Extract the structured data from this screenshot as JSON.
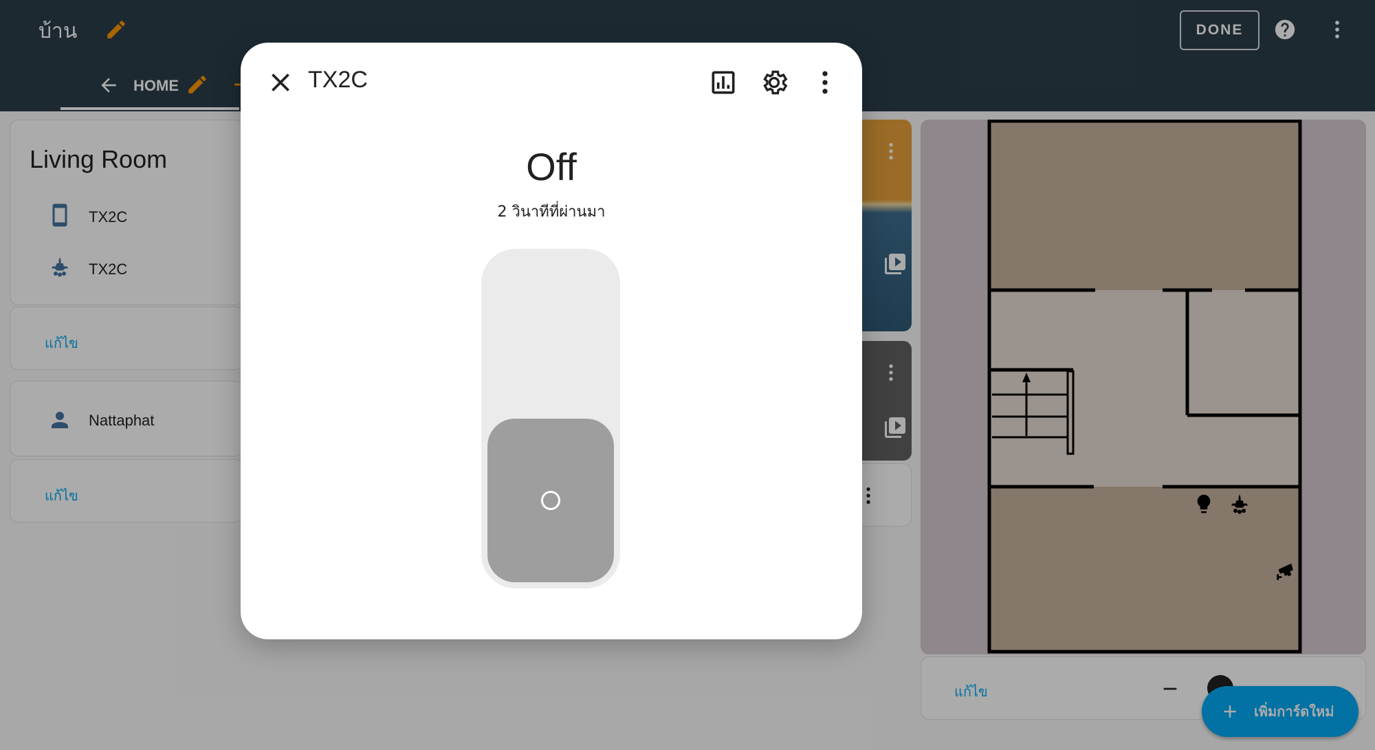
{
  "app": {
    "title": "บ้าน",
    "done_label": "DONE"
  },
  "tabs": {
    "home_label": "HOME"
  },
  "living_room_card": {
    "title": "Living Room",
    "entities": [
      {
        "name": "TX2C",
        "icon": "cellphone-icon"
      },
      {
        "name": "TX2C",
        "icon": "chandelier-icon"
      }
    ],
    "edit_label": "แก้ไข"
  },
  "person_card": {
    "entities": [
      {
        "name": "Nattaphat",
        "icon": "account-icon"
      }
    ],
    "edit_label": "แก้ไข"
  },
  "floorplan_card": {
    "edit_label": "แก้ไข"
  },
  "fab": {
    "label": "เพิ่มการ์ดใหม่"
  },
  "dialog": {
    "title": "TX2C",
    "state": "Off",
    "last_changed": "2 วินาทีที่ผ่านมา",
    "toggle_on": false
  },
  "colors": {
    "topbar": "#2c3e4a",
    "accent_orange": "#ff9800",
    "link_blue": "#03a9f4",
    "toggle_off": "#9e9e9e"
  }
}
